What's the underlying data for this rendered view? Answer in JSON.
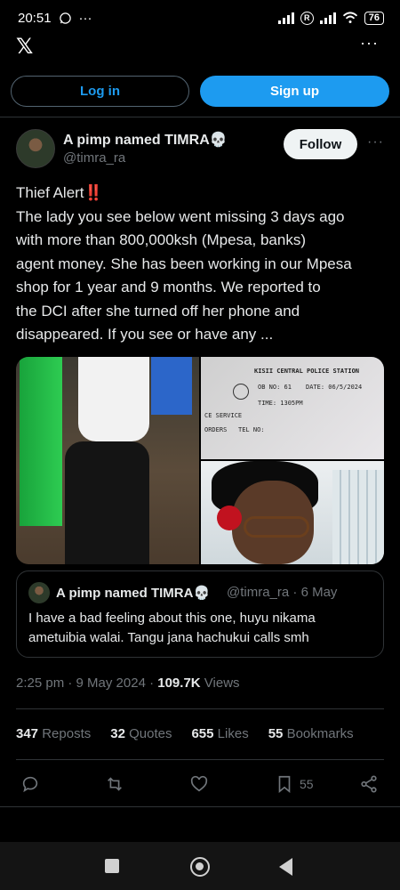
{
  "status_bar": {
    "time": "20:51",
    "whatsapp_icon": "whatsapp-icon",
    "overflow": "···",
    "battery": "76"
  },
  "header": {
    "logo": "𝕏",
    "more": "···"
  },
  "auth": {
    "login_label": "Log in",
    "signup_label": "Sign up"
  },
  "author": {
    "name": "A pimp named TIMRA💀",
    "handle": "@timra_ra",
    "follow_label": "Follow",
    "more": "···"
  },
  "tweet": {
    "lines": [
      "Thief Alert‼️",
      "The lady you see below went missing 3 days ago",
      "with more than 800,000ksh (Mpesa, banks)",
      "agent money. She has been working in our Mpesa",
      "shop  for  1 year and 9 months. We reported to",
      "the DCI after she turned off her phone and",
      "disappeared. If you see or have any ..."
    ]
  },
  "media": {
    "doc_station": "KISII CENTRAL POLICE STATION",
    "doc_ob": "OB NO: 61",
    "doc_date": "DATE: 06/5/2024",
    "doc_time": "TIME: 1305PM",
    "doc_service": "CE SERVICE",
    "doc_orders": "ORDERS",
    "doc_tel": "TEL NO:"
  },
  "quote": {
    "name": "A pimp named TIMRA💀",
    "meta": "@timra_ra · 6 May",
    "text": "I have a bad feeling about this one, huyu nikama ametuibia walai. Tangu jana hachukui calls smh"
  },
  "meta": {
    "time_date": "2:25 pm · 9 May 2024 · ",
    "views_count": "109.7K",
    "views_label": " Views"
  },
  "stats": {
    "reposts_count": "347",
    "reposts_label": "Reposts",
    "quotes_count": "32",
    "quotes_label": "Quotes",
    "likes_count": "655",
    "likes_label": "Likes",
    "bookmarks_count": "55",
    "bookmarks_label": "Bookmarks"
  },
  "actions": {
    "bookmark_count": "55"
  }
}
